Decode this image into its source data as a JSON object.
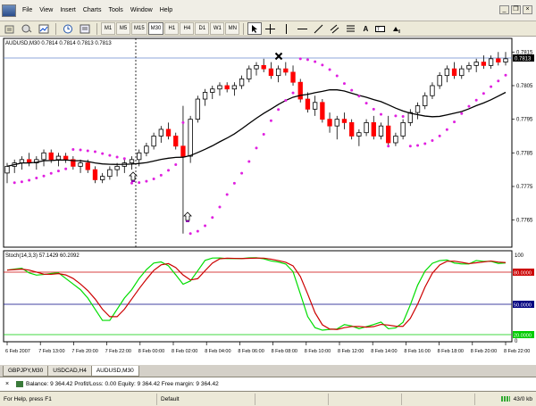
{
  "menubar": {
    "items": [
      "File",
      "View",
      "Insert",
      "Charts",
      "Tools",
      "Window",
      "Help"
    ]
  },
  "toolbar": {
    "timeframes": [
      "M1",
      "M5",
      "M15",
      "M30",
      "H1",
      "H4",
      "D1",
      "W1",
      "MN"
    ],
    "active_timeframe": "M30"
  },
  "chart": {
    "main_label": "AUDUSD,M30  0.7814 0.7814 0.7813 0.7813",
    "price_ticks": [
      "0.7815",
      "0.7805",
      "0.7795",
      "0.7785",
      "0.7775",
      "0.7765"
    ],
    "current_price": "0.7813",
    "time_labels": [
      "6 Feb 2007",
      "7 Feb 13:00",
      "7 Feb 20:00",
      "7 Feb 22:00",
      "8 Feb 00:00",
      "8 Feb 02:00",
      "8 Feb 04:00",
      "8 Feb 06:00",
      "8 Feb 08:00",
      "8 Feb 10:00",
      "8 Feb 12:00",
      "8 Feb 14:00",
      "8 Feb 16:00",
      "8 Feb 18:00",
      "8 Feb 20:00",
      "8 Feb 22:00"
    ]
  },
  "stoch": {
    "label": "Stoch(14,3,3) 57.1429 60.2092",
    "levels": [
      "100",
      "80.0000",
      "50.0000",
      "20.0000",
      "0"
    ]
  },
  "tabs": {
    "items": [
      "GBPJPY,M30",
      "USDCAD,H4",
      "AUDUSD,M30"
    ],
    "active": "AUDUSD,M30"
  },
  "terminal": {
    "account_line": "Balance: 9 364.42  Profit/Loss: 0.00  Equity: 9 364.42  Free margin: 9 364.42"
  },
  "status": {
    "help": "For Help, press F1",
    "profile": "Default",
    "traffic": "43/0 kb"
  },
  "colors": {
    "bull_candle": "#ffffff",
    "bear_candle": "#ff0000",
    "sar": "#e020e0",
    "ma": "#000000",
    "stoch_main": "#00dd00",
    "stoch_signal": "#cc0000",
    "level_80": "#cc0000",
    "level_50": "#000080",
    "level_20": "#00cc00"
  },
  "chart_data": {
    "type": "candlestick",
    "symbol": "AUDUSD",
    "timeframe": "M30",
    "ylim": [
      0.7758,
      0.7818
    ],
    "candles": [
      [
        0.7779,
        0.7782,
        0.7776,
        0.7781
      ],
      [
        0.7781,
        0.7783,
        0.7779,
        0.7782
      ],
      [
        0.7782,
        0.7784,
        0.778,
        0.7783
      ],
      [
        0.7783,
        0.7785,
        0.7781,
        0.7782
      ],
      [
        0.7782,
        0.7784,
        0.778,
        0.7783
      ],
      [
        0.7783,
        0.7786,
        0.7781,
        0.7785
      ],
      [
        0.7785,
        0.7786,
        0.7782,
        0.7783
      ],
      [
        0.7783,
        0.7785,
        0.7781,
        0.7784
      ],
      [
        0.7784,
        0.7785,
        0.7782,
        0.7783
      ],
      [
        0.7783,
        0.7784,
        0.778,
        0.7781
      ],
      [
        0.7781,
        0.7783,
        0.7779,
        0.7782
      ],
      [
        0.7782,
        0.7783,
        0.7779,
        0.778
      ],
      [
        0.778,
        0.7781,
        0.7776,
        0.7777
      ],
      [
        0.7777,
        0.7779,
        0.7776,
        0.7778
      ],
      [
        0.7778,
        0.7781,
        0.7777,
        0.778
      ],
      [
        0.778,
        0.7782,
        0.7778,
        0.7781
      ],
      [
        0.7781,
        0.7783,
        0.7779,
        0.7782
      ],
      [
        0.7782,
        0.7784,
        0.778,
        0.7783
      ],
      [
        0.7783,
        0.7786,
        0.7781,
        0.7785
      ],
      [
        0.7785,
        0.7788,
        0.7784,
        0.7787
      ],
      [
        0.7787,
        0.7791,
        0.7786,
        0.779
      ],
      [
        0.779,
        0.7793,
        0.7788,
        0.7792
      ],
      [
        0.7792,
        0.7794,
        0.7789,
        0.779
      ],
      [
        0.779,
        0.7791,
        0.7786,
        0.7787
      ],
      [
        0.7787,
        0.7799,
        0.7761,
        0.7784
      ],
      [
        0.7784,
        0.7796,
        0.7782,
        0.7795
      ],
      [
        0.7795,
        0.7802,
        0.7794,
        0.7801
      ],
      [
        0.7801,
        0.7804,
        0.7799,
        0.7803
      ],
      [
        0.7803,
        0.7805,
        0.7801,
        0.7804
      ],
      [
        0.7804,
        0.7806,
        0.7802,
        0.7805
      ],
      [
        0.7805,
        0.7806,
        0.7803,
        0.7804
      ],
      [
        0.7804,
        0.7806,
        0.7802,
        0.7805
      ],
      [
        0.7805,
        0.7808,
        0.7804,
        0.7807
      ],
      [
        0.7807,
        0.7811,
        0.7806,
        0.781
      ],
      [
        0.781,
        0.7812,
        0.7808,
        0.7811
      ],
      [
        0.7811,
        0.7813,
        0.7809,
        0.781
      ],
      [
        0.781,
        0.7812,
        0.7807,
        0.7808
      ],
      [
        0.7808,
        0.7811,
        0.7806,
        0.781
      ],
      [
        0.781,
        0.7812,
        0.7808,
        0.7809
      ],
      [
        0.7809,
        0.7811,
        0.7805,
        0.7806
      ],
      [
        0.7806,
        0.7807,
        0.78,
        0.7801
      ],
      [
        0.7801,
        0.7803,
        0.7797,
        0.7798
      ],
      [
        0.7798,
        0.7802,
        0.7796,
        0.78
      ],
      [
        0.78,
        0.7801,
        0.7794,
        0.7795
      ],
      [
        0.7795,
        0.7797,
        0.7791,
        0.7793
      ],
      [
        0.7793,
        0.7796,
        0.7789,
        0.7795
      ],
      [
        0.7795,
        0.7797,
        0.7792,
        0.7794
      ],
      [
        0.7794,
        0.7795,
        0.7789,
        0.779
      ],
      [
        0.779,
        0.7792,
        0.7787,
        0.7791
      ],
      [
        0.7791,
        0.7795,
        0.779,
        0.7794
      ],
      [
        0.7794,
        0.7796,
        0.7789,
        0.779
      ],
      [
        0.779,
        0.7794,
        0.7789,
        0.7793
      ],
      [
        0.7793,
        0.7796,
        0.7787,
        0.7788
      ],
      [
        0.7788,
        0.7791,
        0.7787,
        0.779
      ],
      [
        0.779,
        0.7795,
        0.7789,
        0.7794
      ],
      [
        0.7794,
        0.7798,
        0.7793,
        0.7797
      ],
      [
        0.7797,
        0.78,
        0.7795,
        0.7799
      ],
      [
        0.7799,
        0.7803,
        0.7798,
        0.7802
      ],
      [
        0.7802,
        0.7806,
        0.7801,
        0.7805
      ],
      [
        0.7805,
        0.7809,
        0.7804,
        0.7808
      ],
      [
        0.7808,
        0.7811,
        0.7806,
        0.781
      ],
      [
        0.781,
        0.7812,
        0.7807,
        0.7808
      ],
      [
        0.7808,
        0.7811,
        0.7807,
        0.781
      ],
      [
        0.781,
        0.7812,
        0.7809,
        0.7811
      ],
      [
        0.7811,
        0.7813,
        0.7809,
        0.7812
      ],
      [
        0.7812,
        0.7814,
        0.781,
        0.7811
      ],
      [
        0.7811,
        0.7814,
        0.781,
        0.7813
      ],
      [
        0.7813,
        0.7815,
        0.7811,
        0.7812
      ],
      [
        0.7812,
        0.7815,
        0.7811,
        0.7813
      ]
    ],
    "ma_period": 20,
    "sar_af": 0.02,
    "sar_max": 0.2,
    "stochastic": {
      "k": 14,
      "d": 3,
      "slowing": 3,
      "main_last": 57.1429,
      "signal_last": 60.2092,
      "levels": [
        20,
        50,
        80
      ]
    }
  }
}
